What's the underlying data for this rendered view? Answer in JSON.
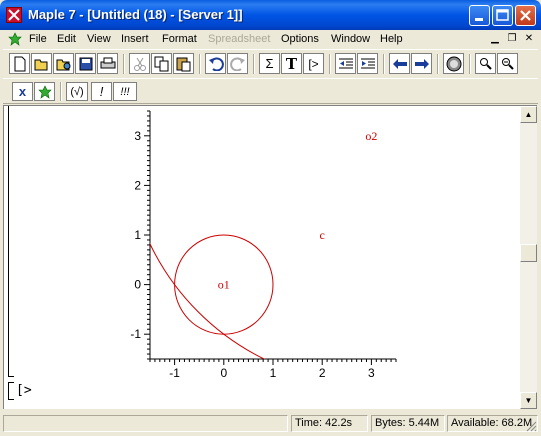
{
  "window": {
    "title": "Maple 7  - [Untitled (18) - [Server 1]]",
    "icon": "maple-leaf-icon",
    "controls": [
      "minimize-icon",
      "maximize-icon",
      "close-icon"
    ]
  },
  "menubar": {
    "items": [
      {
        "label": "File",
        "enabled": true
      },
      {
        "label": "Edit",
        "enabled": true
      },
      {
        "label": "View",
        "enabled": true
      },
      {
        "label": "Insert",
        "enabled": true
      },
      {
        "label": "Format",
        "enabled": true
      },
      {
        "label": "Spreadsheet",
        "enabled": false
      },
      {
        "label": "Options",
        "enabled": true
      },
      {
        "label": "Window",
        "enabled": true
      },
      {
        "label": "Help",
        "enabled": true
      }
    ]
  },
  "toolbar": {
    "buttons": [
      "new-document-icon",
      "open-icon",
      "open-url-icon",
      "save-icon",
      "print-icon",
      "cut-icon",
      "copy-icon",
      "paste-icon",
      "undo-icon",
      "redo-icon",
      "sigma-icon",
      "text-icon",
      "prompt-icon",
      "outdent-icon",
      "indent-icon",
      "back-arrow-icon",
      "forward-arrow-icon",
      "stop-icon",
      "zoom-in-icon",
      "zoom-out-icon"
    ],
    "sigma": "Σ",
    "text": "T",
    "prompt": "[>"
  },
  "context_toolbar": {
    "buttons": [
      "x-icon",
      "maple-leaf-icon",
      "(√)",
      "!",
      "!!!"
    ],
    "items": [
      "(√)",
      "!",
      "!!!"
    ]
  },
  "document": {
    "prompt": "[>"
  },
  "chart_data": {
    "type": "scatter",
    "xlim": [
      -1.5,
      3.5
    ],
    "ylim": [
      -1.5,
      3.5
    ],
    "xticks": [
      "-1",
      "0",
      "1",
      "2",
      "3"
    ],
    "yticks": [
      "-1",
      "0",
      "1",
      "2",
      "3"
    ],
    "color": "#cc0000",
    "circles": [
      {
        "cx": 0,
        "cy": 0,
        "r": 1
      },
      {
        "cx": 3,
        "cy": 3,
        "r": 5
      }
    ],
    "labels": [
      {
        "text": "o1",
        "x": 0,
        "y": 0
      },
      {
        "text": "o2",
        "x": 3,
        "y": 3
      },
      {
        "text": "c",
        "x": 2,
        "y": 1
      }
    ]
  },
  "statusbar": {
    "time": "Time:  42.2s",
    "bytes": "Bytes: 5.44M",
    "available": "Available: 68.2M"
  }
}
